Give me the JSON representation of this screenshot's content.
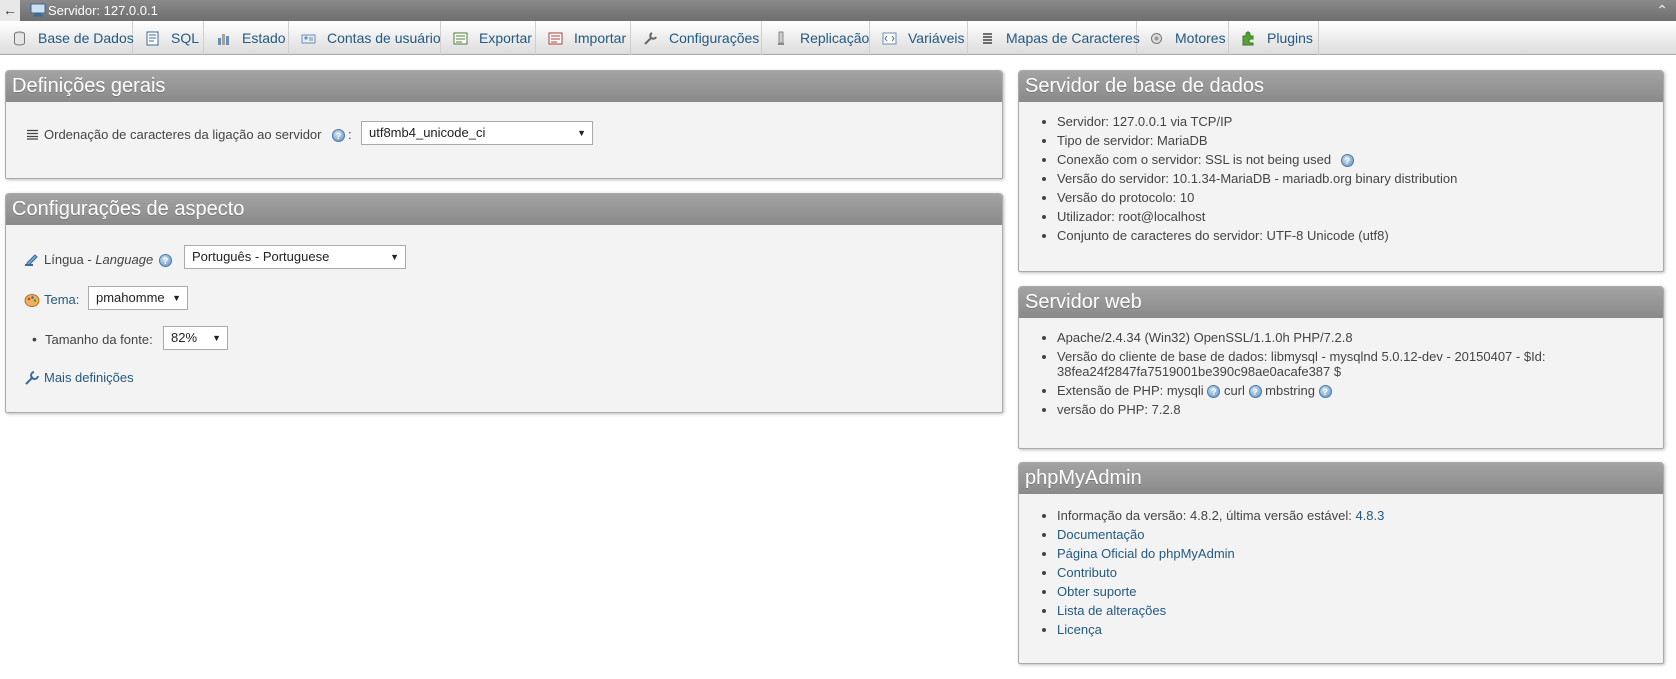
{
  "topbar": {
    "title": "Servidor: 127.0.0.1",
    "back": "←",
    "collapse": "⌃"
  },
  "tabs": [
    {
      "label": "Base de Dados",
      "icon": "database-icon"
    },
    {
      "label": "SQL",
      "icon": "sql-icon"
    },
    {
      "label": "Estado",
      "icon": "status-icon"
    },
    {
      "label": "Contas de usuário",
      "icon": "users-icon"
    },
    {
      "label": "Exportar",
      "icon": "export-icon"
    },
    {
      "label": "Importar",
      "icon": "import-icon"
    },
    {
      "label": "Configurações",
      "icon": "wrench-icon"
    },
    {
      "label": "Replicação",
      "icon": "replication-icon"
    },
    {
      "label": "Variáveis",
      "icon": "variables-icon"
    },
    {
      "label": "Mapas de Caracteres",
      "icon": "charset-icon"
    },
    {
      "label": "Motores",
      "icon": "engine-icon"
    },
    {
      "label": "Plugins",
      "icon": "plugin-icon"
    }
  ],
  "general": {
    "title": "Definições gerais",
    "collation_label": "Ordenação de caracteres da ligação ao servidor",
    "collation_colon": ":",
    "collation_value": "utf8mb4_unicode_ci"
  },
  "appearance": {
    "title": "Configurações de aspecto",
    "language_label": "Língua - ",
    "language_label_italic": "Language",
    "language_value": "Português - Portuguese",
    "theme_label": "Tema:",
    "theme_value": "pmahomme",
    "font_label": "Tamanho da fonte:",
    "font_value": "82%",
    "more_settings": "Mais definições"
  },
  "db_server": {
    "title": "Servidor de base de dados",
    "items": [
      "Servidor: 127.0.0.1 via TCP/IP",
      "Tipo de servidor: MariaDB",
      "Conexão com o servidor: SSL is not being used",
      "Versão do servidor: 10.1.34-MariaDB - mariadb.org binary distribution",
      "Versão do protocolo: 10",
      "Utilizador: root@localhost",
      "Conjunto de caracteres do servidor: UTF-8 Unicode (utf8)"
    ]
  },
  "web_server": {
    "title": "Servidor web",
    "apache": "Apache/2.4.34 (Win32) OpenSSL/1.1.0h PHP/7.2.8",
    "client_line1": "Versão do cliente de base de dados: libmysql - mysqlnd 5.0.12-dev - 20150407 - $Id:",
    "client_line2": "38fea24f2847fa7519001be390c98ae0acafe387 $",
    "php_ext_label": "Extensão de PHP: mysqli",
    "php_ext_curl": "curl",
    "php_ext_mbstring": "mbstring",
    "php_version": "versão do PHP: 7.2.8"
  },
  "pma": {
    "title": "phpMyAdmin",
    "version_info": "Informação da versão: 4.8.2, última versão estável: ",
    "latest": "4.8.3",
    "links": [
      "Documentação",
      "Página Oficial do phpMyAdmin",
      "Contributo",
      "Obter suporte",
      "Lista de alterações",
      "Licença"
    ]
  },
  "colors": {
    "link": "#235a81",
    "header": "#8f8f8f",
    "panel_bg": "#f3f3f3"
  }
}
